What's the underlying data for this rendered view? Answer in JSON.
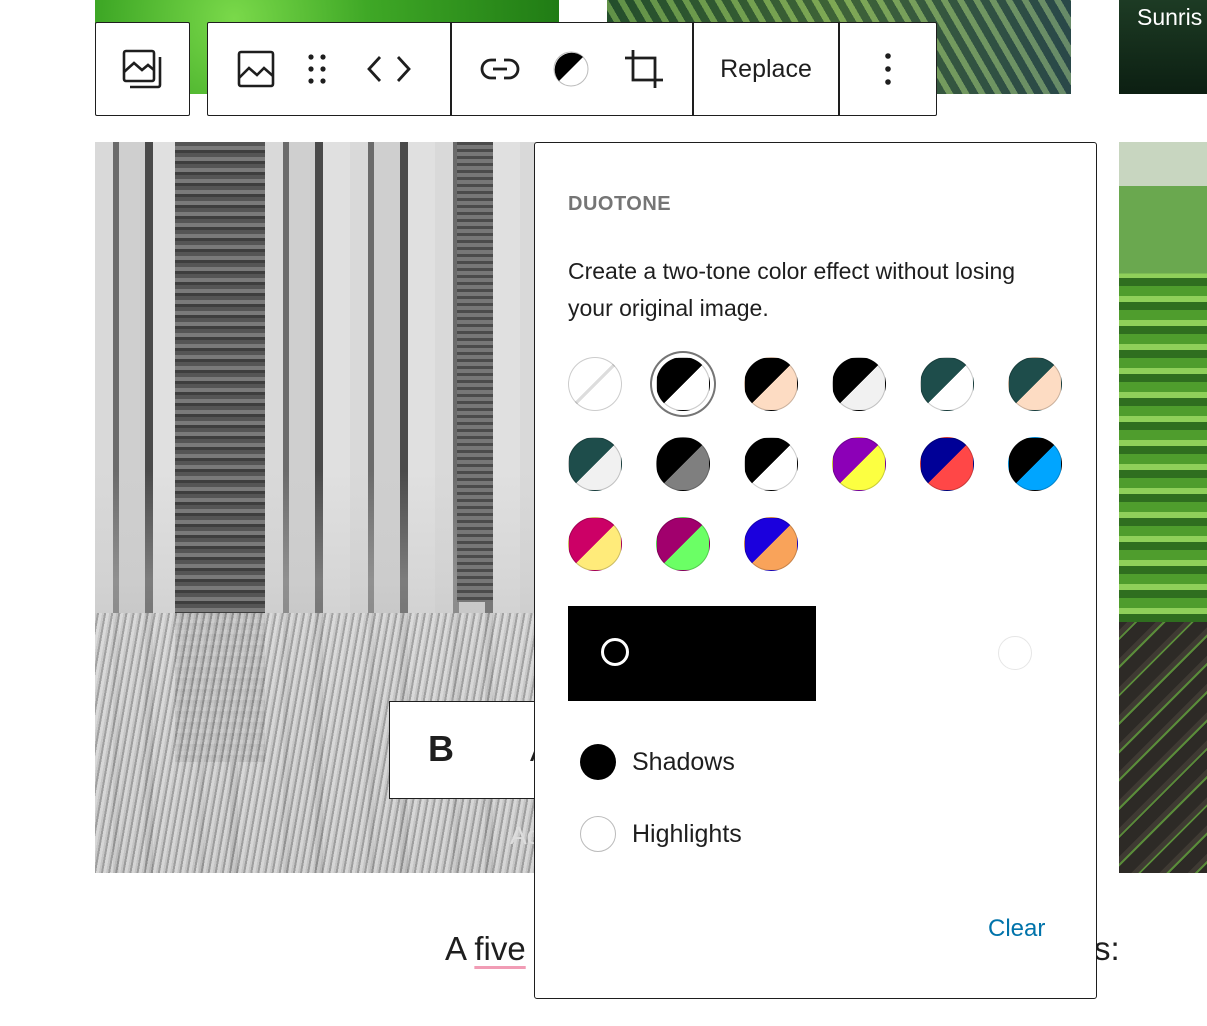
{
  "images": {
    "top_right_caption": "Sunris",
    "overlay_text": "Ac"
  },
  "block_toolbar": {
    "buttons": [
      {
        "name": "gallery-icon"
      },
      {
        "name": "image-icon"
      },
      {
        "name": "drag-handle-icon"
      },
      {
        "name": "move-arrows-icon"
      },
      {
        "name": "link-icon"
      },
      {
        "name": "duotone-icon"
      },
      {
        "name": "crop-icon"
      }
    ],
    "replace_label": "Replace",
    "more_options": "more-options-icon"
  },
  "format_toolbar": {
    "bold_label": "B",
    "italic_peek": "A"
  },
  "paragraph": {
    "start": "A ",
    "underlined": "five",
    "end": "s:"
  },
  "duotone_popover": {
    "heading": "DUOTONE",
    "description": "Create a two-tone color effect without losing your original image.",
    "presets": [
      {
        "name": "none",
        "shadow": "#ffffff",
        "highlight": "#ffffff"
      },
      {
        "name": "black-white",
        "shadow": "#000000",
        "highlight": "#ffffff",
        "selected": true
      },
      {
        "name": "black-peach",
        "shadow": "#000000",
        "highlight": "#fddcc3"
      },
      {
        "name": "black-lightgray",
        "shadow": "#000000",
        "highlight": "#f1f1f1"
      },
      {
        "name": "darkteal-white",
        "shadow": "#1e4d4b",
        "highlight": "#ffffff"
      },
      {
        "name": "darkteal-peach",
        "shadow": "#1e4d4b",
        "highlight": "#fddcc3"
      },
      {
        "name": "darkteal-lightgray",
        "shadow": "#1e4d4b",
        "highlight": "#f1f1f1"
      },
      {
        "name": "black-gray",
        "shadow": "#000000",
        "highlight": "#7f7f7f"
      },
      {
        "name": "black-white-2",
        "shadow": "#000000",
        "highlight": "#ffffff"
      },
      {
        "name": "purple-yellow",
        "shadow": "#8c00b7",
        "highlight": "#fcff41"
      },
      {
        "name": "blue-red",
        "shadow": "#000097",
        "highlight": "#ff4747"
      },
      {
        "name": "black-skyblue",
        "shadow": "#000000",
        "highlight": "#00a5ff"
      },
      {
        "name": "crimson-yellow",
        "shadow": "#cc0066",
        "highlight": "#ffeb7a"
      },
      {
        "name": "magenta-green",
        "shadow": "#a1006d",
        "highlight": "#6bff65"
      },
      {
        "name": "blue-orange",
        "shadow": "#1b00dd",
        "highlight": "#f9a35a"
      }
    ],
    "custom_shadow_color": "#000000",
    "options": [
      {
        "label": "Shadows",
        "color": "#000000"
      },
      {
        "label": "Highlights",
        "color": "#ffffff"
      }
    ],
    "clear_label": "Clear"
  }
}
